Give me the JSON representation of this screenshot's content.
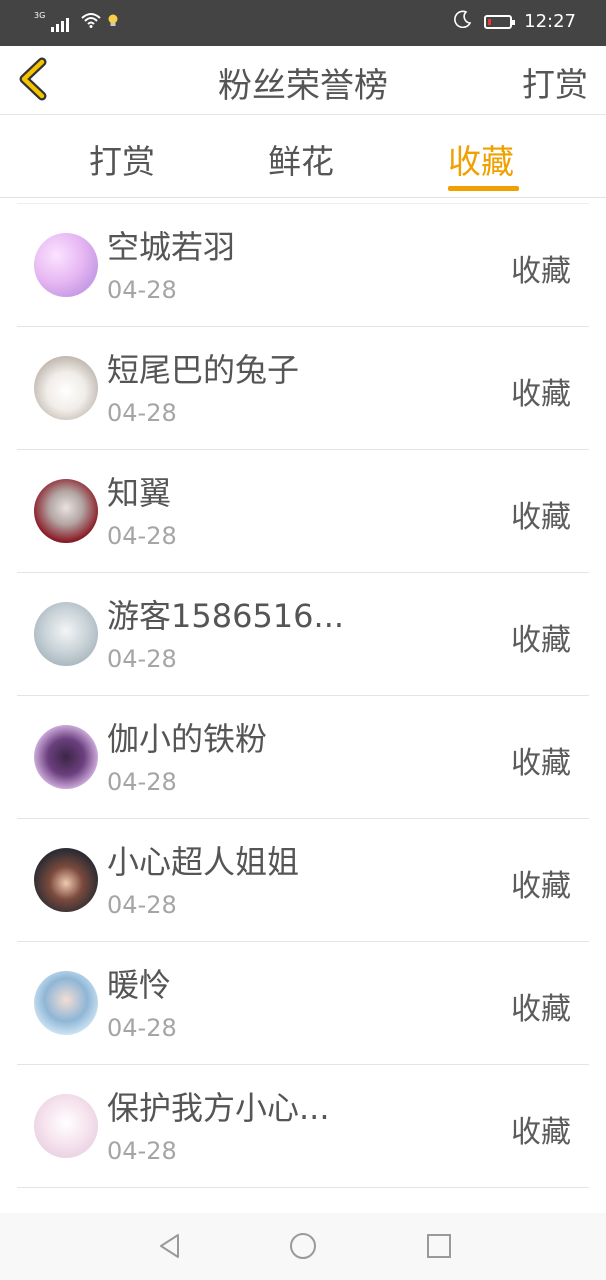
{
  "status": {
    "network": "3G",
    "time": "12:27",
    "battery_level": 0.15,
    "battery_color": "#e53935"
  },
  "header": {
    "title": "粉丝荣誉榜",
    "right_action": "打赏"
  },
  "tabs": [
    {
      "label": "打赏",
      "active": false
    },
    {
      "label": "鲜花",
      "active": false
    },
    {
      "label": "收藏",
      "active": true
    }
  ],
  "accent_color": "#f0a000",
  "list": [
    {
      "name": "空城若羽",
      "date": "04-28",
      "action": "收藏"
    },
    {
      "name": "短尾巴的兔子",
      "date": "04-28",
      "action": "收藏"
    },
    {
      "name": "知翼",
      "date": "04-28",
      "action": "收藏"
    },
    {
      "name": "游客1586516...",
      "date": "04-28",
      "action": "收藏"
    },
    {
      "name": "伽小的铁粉",
      "date": "04-28",
      "action": "收藏"
    },
    {
      "name": "小心超人姐姐",
      "date": "04-28",
      "action": "收藏"
    },
    {
      "name": "暖怜",
      "date": "04-28",
      "action": "收藏"
    },
    {
      "name": "保护我方小心...",
      "date": "04-28",
      "action": "收藏"
    }
  ],
  "icons": {
    "back": "chevron-left-icon",
    "nav_back": "triangle-back-icon",
    "nav_home": "circle-home-icon",
    "nav_recent": "square-recent-icon"
  }
}
